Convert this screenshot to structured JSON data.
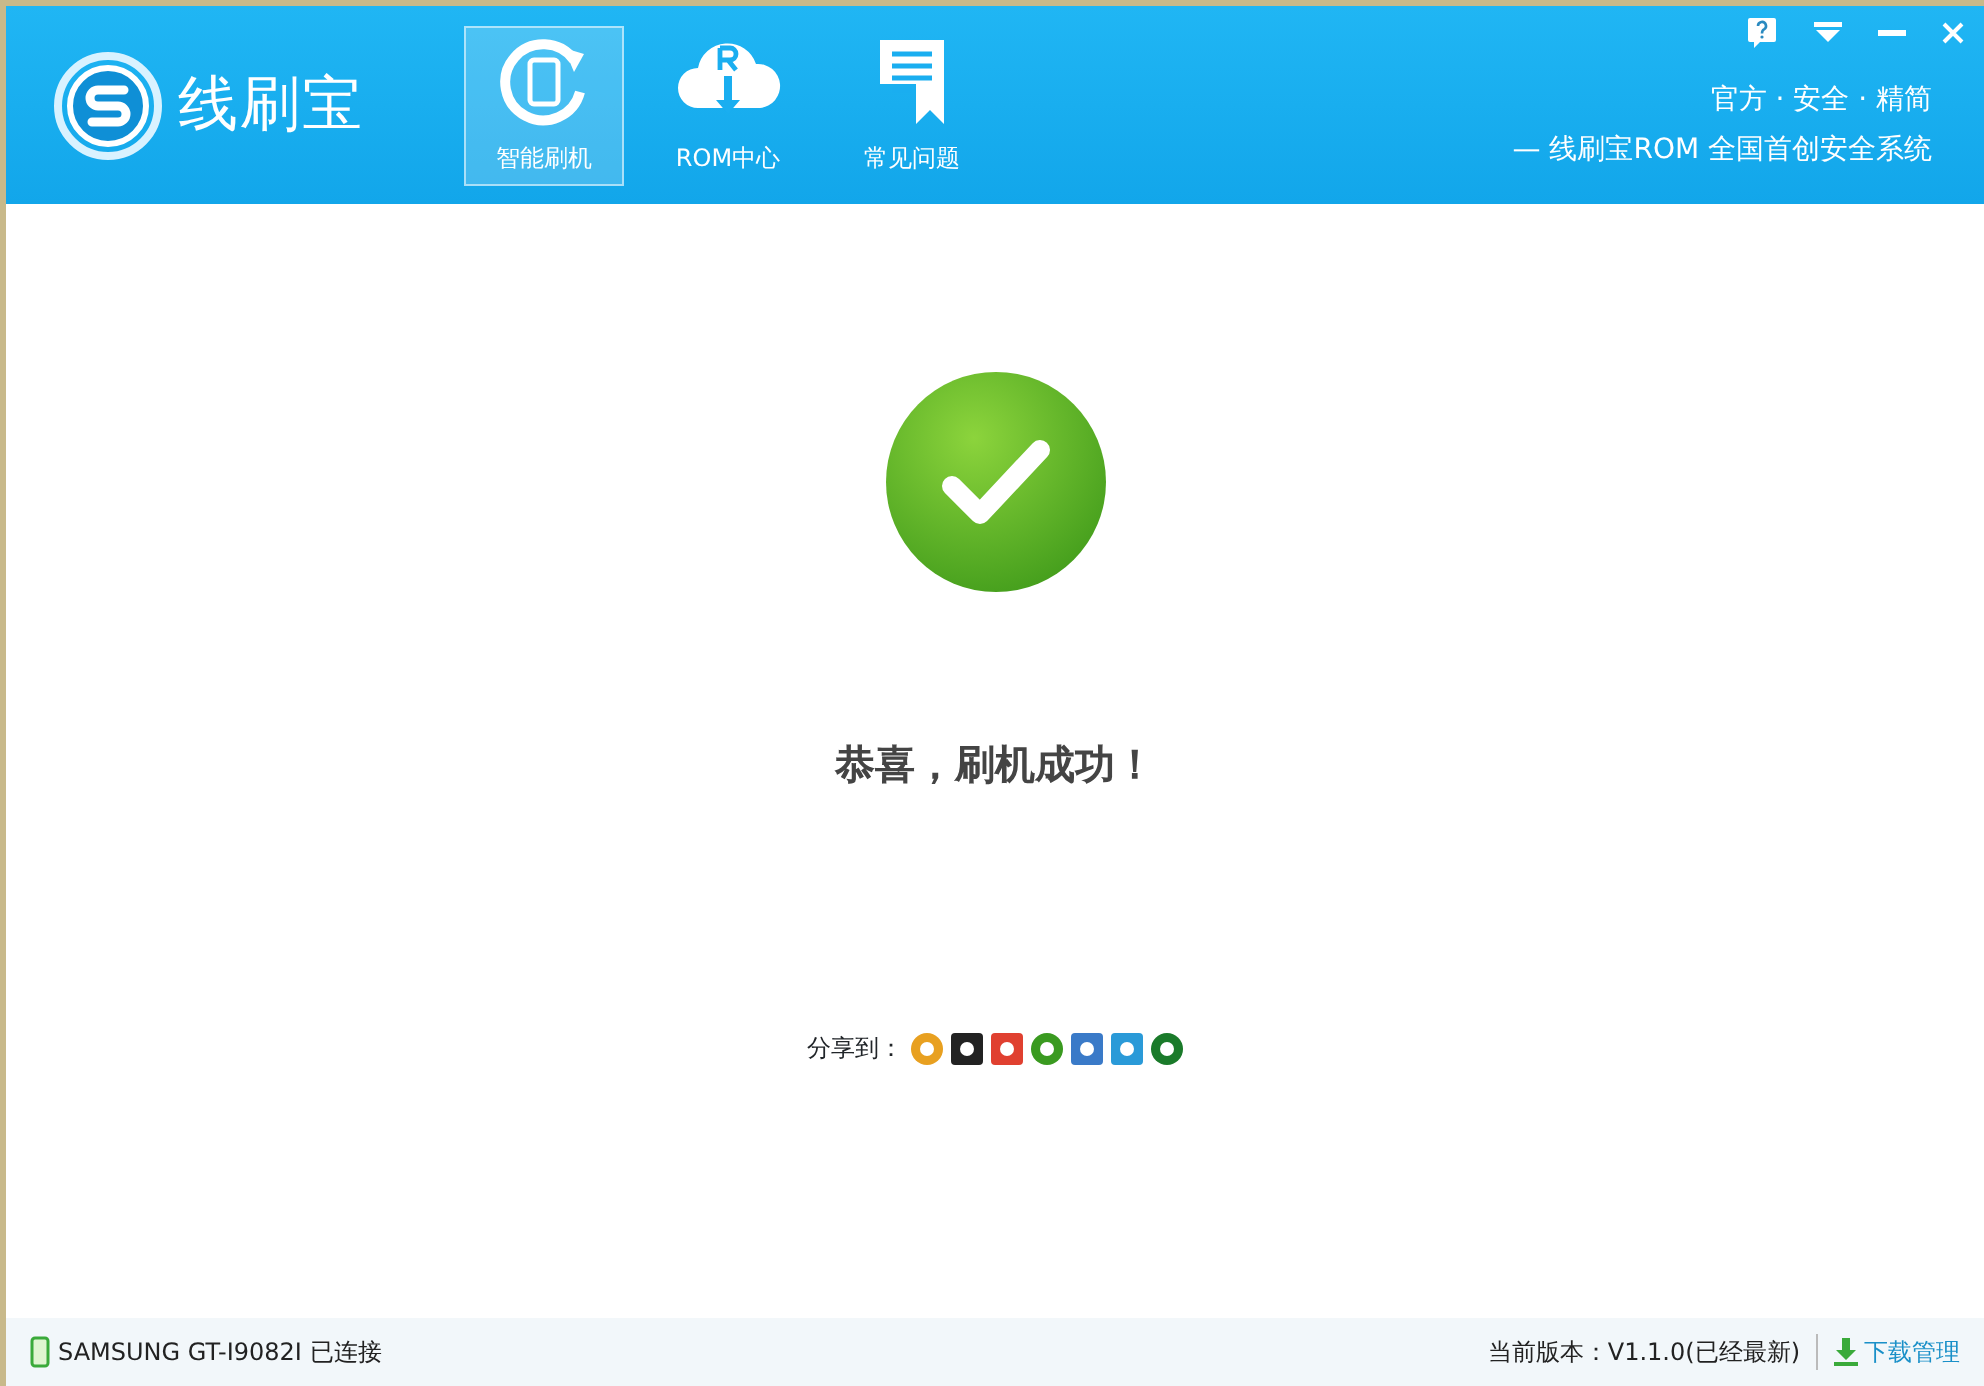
{
  "app": {
    "title": "线刷宝"
  },
  "nav": [
    {
      "label": "智能刷机",
      "selected": true,
      "kind": "flash"
    },
    {
      "label": "ROM中心",
      "selected": false,
      "kind": "cloud"
    },
    {
      "label": "常见问题",
      "selected": false,
      "kind": "doc"
    }
  ],
  "slogan": {
    "line_1": "官方 · 安全 · 精简",
    "line_2": "— 线刷宝ROM  全国首创安全系统"
  },
  "result": {
    "message": "恭喜，刷机成功！"
  },
  "share": {
    "label": "分享到：",
    "targets": [
      {
        "color": "#e8a020"
      },
      {
        "color": "#222222"
      },
      {
        "color": "#e04030"
      },
      {
        "color": "#3a9a20"
      },
      {
        "color": "#3a7ac8"
      },
      {
        "color": "#2a9ad8"
      },
      {
        "color": "#1a7a2a"
      }
    ]
  },
  "status_bar": {
    "device": "SAMSUNG GT-I9082I 已连接",
    "version": "当前版本：V1.1.0(已经最新)",
    "download": "下载管理"
  }
}
